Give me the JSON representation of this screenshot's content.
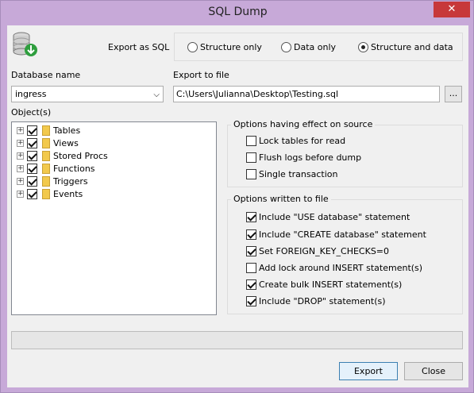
{
  "window": {
    "title": "SQL Dump"
  },
  "export_as": {
    "label": "Export as SQL",
    "options": [
      "Structure only",
      "Data only",
      "Structure and data"
    ],
    "selected": "Structure and data"
  },
  "database": {
    "label": "Database name",
    "value": "ingress"
  },
  "export_file": {
    "label": "Export to file",
    "value": "C:\\Users\\Julianna\\Desktop\\Testing.sql",
    "browse_label": "..."
  },
  "objects": {
    "label": "Object(s)",
    "items": [
      {
        "label": "Tables",
        "checked": true
      },
      {
        "label": "Views",
        "checked": true
      },
      {
        "label": "Stored Procs",
        "checked": true
      },
      {
        "label": "Functions",
        "checked": true
      },
      {
        "label": "Triggers",
        "checked": true
      },
      {
        "label": "Events",
        "checked": true
      }
    ]
  },
  "source_options": {
    "title": "Options having effect on source",
    "items": [
      {
        "label": "Lock tables for read",
        "checked": false
      },
      {
        "label": "Flush logs before dump",
        "checked": false
      },
      {
        "label": "Single transaction",
        "checked": false
      }
    ]
  },
  "file_options": {
    "title": "Options written to file",
    "items": [
      {
        "label": "Include \"USE database\" statement",
        "checked": true
      },
      {
        "label": "Include \"CREATE database\" statement",
        "checked": true
      },
      {
        "label": "Set FOREIGN_KEY_CHECKS=0",
        "checked": true
      },
      {
        "label": "Add lock around INSERT statement(s)",
        "checked": false
      },
      {
        "label": "Create bulk INSERT statement(s)",
        "checked": true
      },
      {
        "label": "Include \"DROP\" statement(s)",
        "checked": true
      }
    ]
  },
  "progress": {
    "value": 0
  },
  "buttons": {
    "export": "Export",
    "close": "Close"
  },
  "colors": {
    "titlebar": "#c7a9d8",
    "close": "#c7383a",
    "folder": "#f2c94c"
  }
}
